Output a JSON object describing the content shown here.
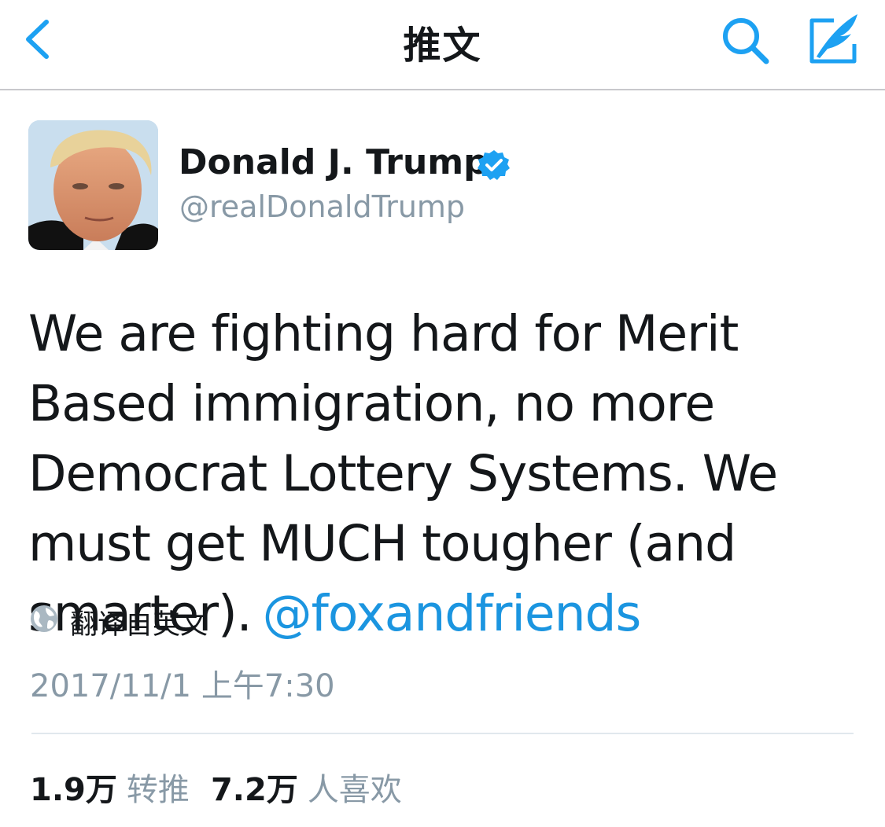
{
  "nav": {
    "title": "推文",
    "back_icon": "chevron-left-icon",
    "search_icon": "search-icon",
    "compose_icon": "compose-tweet-icon",
    "accent": "#1da1f2"
  },
  "author": {
    "name": "Donald J. Trump",
    "handle": "@realDonaldTrump",
    "verified": true,
    "verified_color": "#1da1f2"
  },
  "tweet": {
    "text": "We are fighting hard for Merit Based immigration, no more Democrat Lottery Systems. We must get MUCH tougher (and smarter).",
    "mention": "@foxandfriends",
    "mention_color": "#1b95e0"
  },
  "translate": {
    "icon": "globe-icon",
    "label": "翻译自英文"
  },
  "timestamp": "2017/11/1 上午7:30",
  "stats": {
    "retweets_count": "1.9万",
    "retweets_label": "转推",
    "likes_count": "7.2万",
    "likes_label": "人喜欢"
  }
}
